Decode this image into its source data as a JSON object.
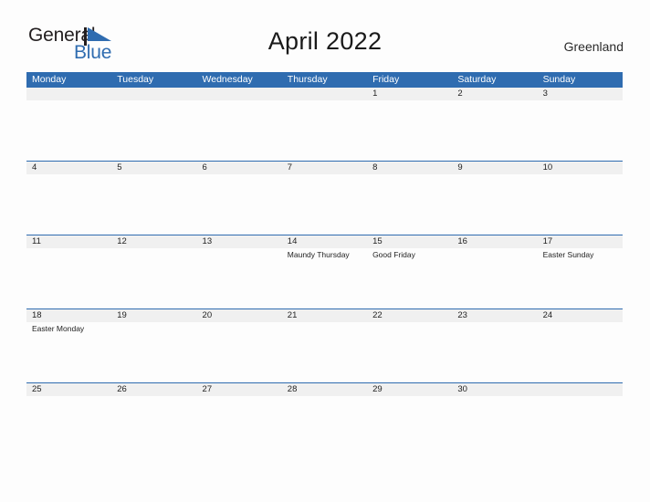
{
  "brand": {
    "name_part1": "General",
    "name_part2": "Blue",
    "flag_icon": "blue-flag-triangle",
    "accent_color": "#2f6cb0",
    "text_color": "#231f20"
  },
  "header": {
    "title": "April 2022",
    "country": "Greenland"
  },
  "calendar": {
    "month": "April",
    "year": "2022",
    "header_bg": "#2f6cb0",
    "date_band_bg": "#f0f0f0",
    "row_rule_color": "#2f6cb0",
    "weekday_headers": [
      "Monday",
      "Tuesday",
      "Wednesday",
      "Thursday",
      "Friday",
      "Saturday",
      "Sunday"
    ],
    "weeks": [
      {
        "days": [
          {
            "num": "",
            "event": ""
          },
          {
            "num": "",
            "event": ""
          },
          {
            "num": "",
            "event": ""
          },
          {
            "num": "",
            "event": ""
          },
          {
            "num": "1",
            "event": ""
          },
          {
            "num": "2",
            "event": ""
          },
          {
            "num": "3",
            "event": ""
          }
        ]
      },
      {
        "days": [
          {
            "num": "4",
            "event": ""
          },
          {
            "num": "5",
            "event": ""
          },
          {
            "num": "6",
            "event": ""
          },
          {
            "num": "7",
            "event": ""
          },
          {
            "num": "8",
            "event": ""
          },
          {
            "num": "9",
            "event": ""
          },
          {
            "num": "10",
            "event": ""
          }
        ]
      },
      {
        "days": [
          {
            "num": "11",
            "event": ""
          },
          {
            "num": "12",
            "event": ""
          },
          {
            "num": "13",
            "event": ""
          },
          {
            "num": "14",
            "event": "Maundy Thursday"
          },
          {
            "num": "15",
            "event": "Good Friday"
          },
          {
            "num": "16",
            "event": ""
          },
          {
            "num": "17",
            "event": "Easter Sunday"
          }
        ]
      },
      {
        "days": [
          {
            "num": "18",
            "event": "Easter Monday"
          },
          {
            "num": "19",
            "event": ""
          },
          {
            "num": "20",
            "event": ""
          },
          {
            "num": "21",
            "event": ""
          },
          {
            "num": "22",
            "event": ""
          },
          {
            "num": "23",
            "event": ""
          },
          {
            "num": "24",
            "event": ""
          }
        ]
      },
      {
        "days": [
          {
            "num": "25",
            "event": ""
          },
          {
            "num": "26",
            "event": ""
          },
          {
            "num": "27",
            "event": ""
          },
          {
            "num": "28",
            "event": ""
          },
          {
            "num": "29",
            "event": ""
          },
          {
            "num": "30",
            "event": ""
          },
          {
            "num": "",
            "event": ""
          }
        ]
      }
    ]
  }
}
